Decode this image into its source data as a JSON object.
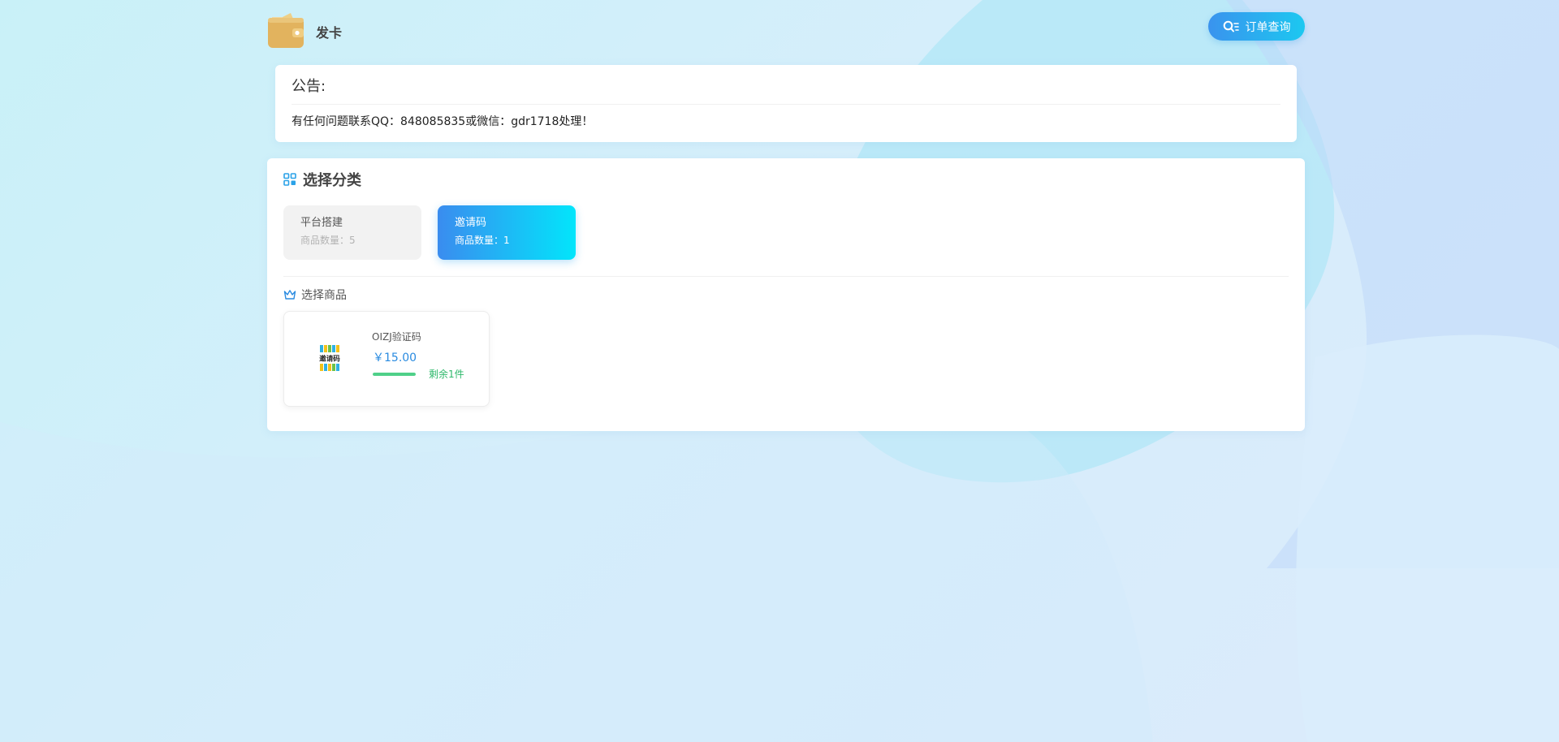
{
  "header": {
    "site_name": "发卡",
    "order_query_label": "订单查询"
  },
  "notice": {
    "title": "公告:",
    "content": "有任何问题联系QQ：848085835或微信：gdr1718处理！"
  },
  "categories_section": {
    "title": "选择分类",
    "items": [
      {
        "name": "平台搭建",
        "count_label": "商品数量：5",
        "active": false
      },
      {
        "name": "邀请码",
        "count_label": "商品数量：1",
        "active": true
      }
    ]
  },
  "products_section": {
    "title": "选择商品",
    "items": [
      {
        "name": "OIZJ验证码",
        "price": "￥15.00",
        "stock_label": "剩余1件",
        "stock_fraction": 1.0,
        "thumb_text": "邀请码"
      }
    ]
  },
  "colors": {
    "accent_start": "#3a8cef",
    "accent_end": "#02e5fb",
    "price": "#2a8be0",
    "stock": "#2cb86a",
    "logo": "#e2b35e"
  },
  "icons": {
    "logo": "wallet-icon",
    "order_query": "search-list-icon",
    "categories": "grid-icon",
    "products": "crown-icon"
  }
}
